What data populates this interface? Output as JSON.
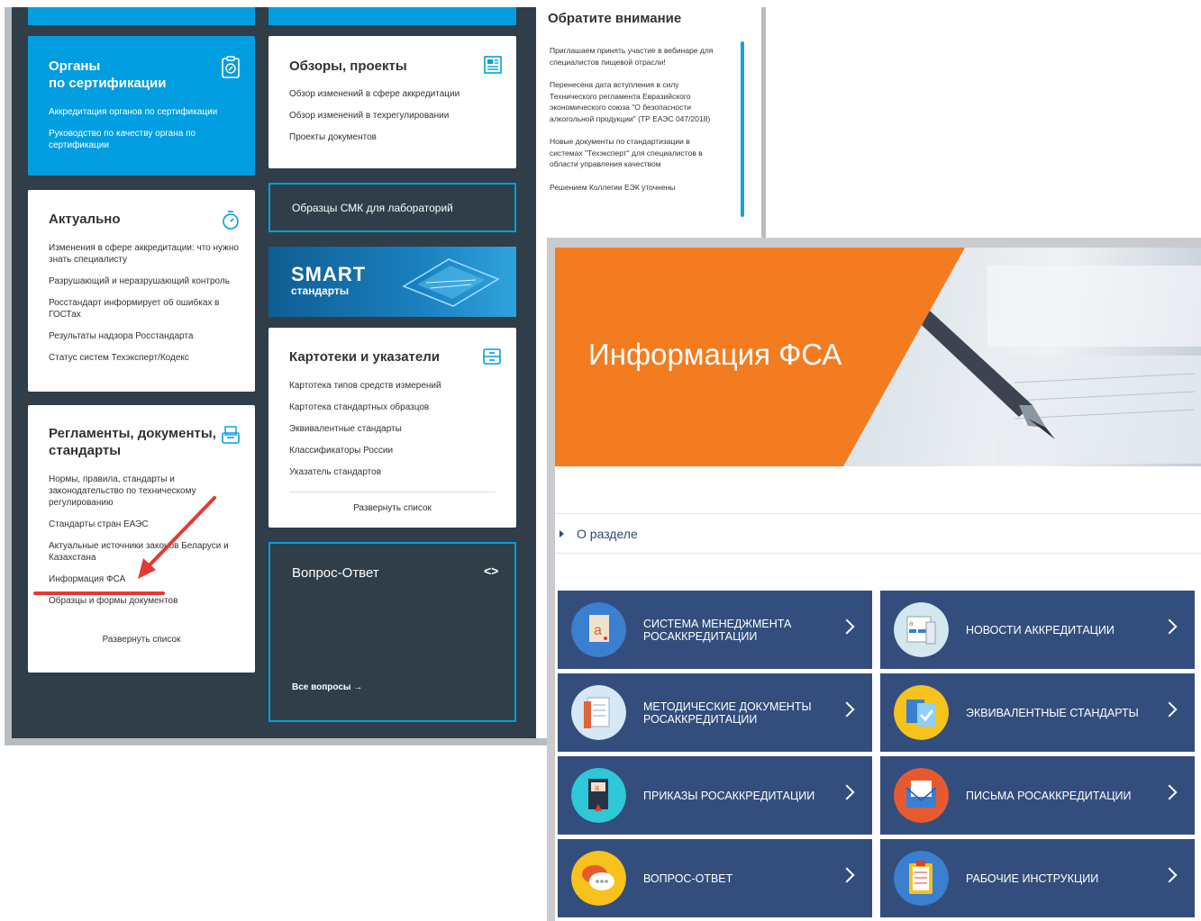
{
  "back_page": {
    "cert_bodies": {
      "title": "Органы\nпо сертификации",
      "links": [
        "Аккредитация органов по сертификации",
        "Руководство по качеству органа по сертификации"
      ]
    },
    "reviews": {
      "title": "Обзоры, проекты",
      "links": [
        "Обзор изменений в сфере аккредитации",
        "Обзор изменений в техрегулировании",
        "Проекты документов"
      ]
    },
    "actual": {
      "title": "Актуально",
      "links": [
        "Изменения в сфере аккредитации: что нужно знать специалисту",
        "Разрушающий и неразрушающий контроль",
        "Росстандарт информирует об ошибках в ГОСТах",
        "Результаты надзора Росстандарта",
        "Статус систем Техэксперт/Кодекс"
      ]
    },
    "smk": {
      "label": "Образцы СМК для лабораторий"
    },
    "smart": {
      "line1": "SMART",
      "line2": "стандарты"
    },
    "catalogs": {
      "title": "Картотеки и указатели",
      "links": [
        "Картотека типов средств измерений",
        "Картотека стандартных образцов",
        "Эквивалентные стандарты",
        "Классификаторы России",
        "Указатель стандартов"
      ],
      "expand": "Развернуть список"
    },
    "regulations": {
      "title": "Регламенты, документы, стандарты",
      "links": [
        "Нормы, правила, стандарты и законодательство по техническому регулированию",
        "Стандарты стран ЕАЭС",
        "Актуальные источники законов Беларуси и Казахстана",
        "Информация ФСА",
        "Образцы и формы документов"
      ],
      "expand": "Развернуть список"
    },
    "qa": {
      "title": "Вопрос-Ответ",
      "all": "Все вопросы"
    },
    "notice": {
      "title": "Обратите внимание",
      "items": [
        "Приглашаем принять участие в вебинаре для специалистов пищевой отрасли!",
        "Перенесена дата вступления в силу Технического регламента Евразийского экономического союза \"О безопасности алкогольной продукции\" (ТР ЕАЭС 047/2018)",
        "Новые документы по стандартизации в системах \"Техэксперт\" для специалистов в области управления качеством",
        "Решением Коллегии ЕЭК уточнены"
      ]
    }
  },
  "front_page": {
    "banner_title": "Информация ФСА",
    "about": "О разделе",
    "tiles": [
      {
        "label": "СИСТЕМА МЕНЕДЖМЕНТА РОСАККРЕДИТАЦИИ",
        "icon": "document-a-icon"
      },
      {
        "label": "НОВОСТИ АККРЕДИТАЦИИ",
        "icon": "news-icon"
      },
      {
        "label": "МЕТОДИЧЕСКИЕ ДОКУМЕНТЫ РОСАККРЕДИТАЦИИ",
        "icon": "book-icon"
      },
      {
        "label": "ЭКВИВАЛЕНТНЫЕ СТАНДАРТЫ",
        "icon": "check-docs-icon"
      },
      {
        "label": "ПРИКАЗЫ РОСАККРЕДИТАЦИИ",
        "icon": "order-icon"
      },
      {
        "label": "ПИСЬМА РОСАККРЕДИТАЦИИ",
        "icon": "envelope-icon"
      },
      {
        "label": "ВОПРОС-ОТВЕТ",
        "icon": "chat-icon"
      },
      {
        "label": "РАБОЧИЕ ИНСТРУКЦИИ",
        "icon": "clipboard-icon"
      }
    ]
  },
  "colors": {
    "dark_bg": "#2f3e48",
    "accent_blue": "#009ee0",
    "tile_blue": "#334e7d",
    "orange": "#f47c20",
    "arrow_red": "#e53935"
  }
}
